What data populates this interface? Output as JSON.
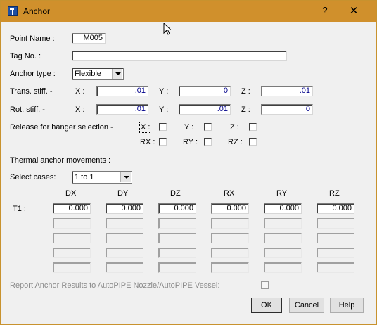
{
  "window": {
    "title": "Anchor",
    "help": "?",
    "close": "✕"
  },
  "point_name": {
    "label": "Point Name  :",
    "value": "M005"
  },
  "tag_no": {
    "label": "Tag No. :",
    "value": ""
  },
  "anchor_type": {
    "label": "Anchor type :",
    "value": "Flexible"
  },
  "trans_stiff": {
    "label": "Trans. stiff.  -",
    "x_label": "X :",
    "y_label": "Y :",
    "z_label": "Z :",
    "x": ".01",
    "y": "0",
    "z": ".01"
  },
  "rot_stiff": {
    "label": "Rot. stiff.   -",
    "x_label": "X :",
    "y_label": "Y :",
    "z_label": "Z :",
    "x": ".01",
    "y": ".01",
    "z": "0"
  },
  "release": {
    "label": "Release for hanger selection -",
    "x_label": "X :",
    "y_label": "Y :",
    "z_label": "Z :",
    "rx_label": "RX :",
    "ry_label": "RY :",
    "rz_label": "RZ :"
  },
  "thermal": {
    "label": "Thermal anchor movements :",
    "select_label": "Select cases:",
    "select_value": "1 to 1",
    "columns": [
      "DX",
      "DY",
      "DZ",
      "RX",
      "RY",
      "RZ"
    ],
    "row_label": "T1  :",
    "row_values": [
      "0.000",
      "0.000",
      "0.000",
      "0.000",
      "0.000",
      "0.000"
    ]
  },
  "report": {
    "label": "Report Anchor Results to AutoPIPE Nozzle/AutoPIPE Vessel:"
  },
  "buttons": {
    "ok": "OK",
    "cancel": "Cancel",
    "help": "Help"
  }
}
